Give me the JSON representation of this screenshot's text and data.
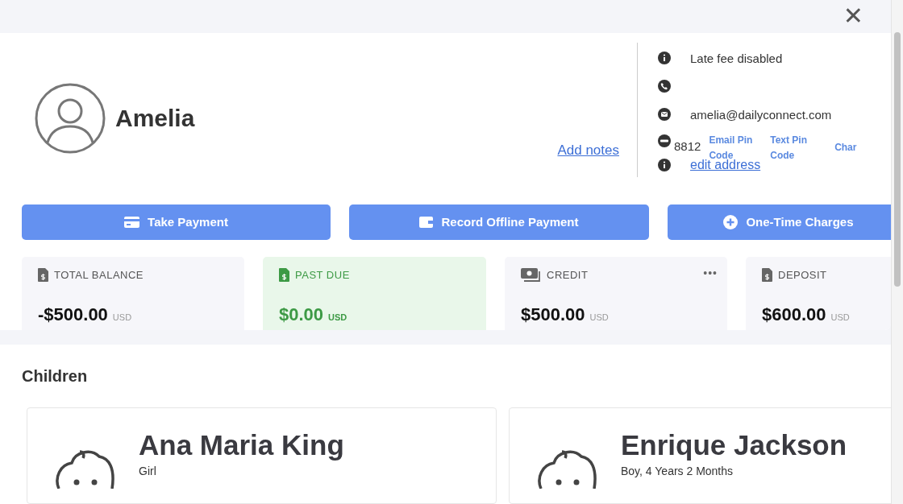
{
  "close_label": "✕",
  "profile": {
    "name": "Amelia",
    "add_notes": "Add notes"
  },
  "info": [
    {
      "kind": "info",
      "text": "Late fee disabled"
    },
    {
      "kind": "phone"
    },
    {
      "kind": "email",
      "text": "amelia@dailyconnect.com"
    },
    {
      "kind": "pin",
      "text": "8812",
      "links": [
        [
          "Email Pin",
          "Code"
        ],
        [
          "Text Pin",
          "Code"
        ],
        [
          "Char"
        ]
      ]
    },
    {
      "kind": "address",
      "link": "edit address"
    }
  ],
  "actions": [
    {
      "kind": "card",
      "label": "Take Payment"
    },
    {
      "kind": "wallet",
      "label": "Record Offline Payment"
    },
    {
      "kind": "plus",
      "label": "One-Time Charges"
    }
  ],
  "balances": [
    {
      "kind": "doc",
      "label": "TOTAL BALANCE",
      "amount": "-$500.00",
      "currency": "USD",
      "highlight": false
    },
    {
      "kind": "doc",
      "label": "PAST DUE",
      "amount": "$0.00",
      "currency": "USD",
      "highlight": true
    },
    {
      "kind": "cash",
      "label": "CREDIT",
      "amount": "$500.00",
      "currency": "USD",
      "highlight": false,
      "menu": "•••"
    },
    {
      "kind": "doc",
      "label": "DEPOSIT",
      "amount": "$600.00",
      "currency": "USD",
      "highlight": false
    }
  ],
  "children_title": "Children",
  "children": [
    {
      "name": "Ana Maria King",
      "detail": "Girl"
    },
    {
      "name": "Enrique Jackson",
      "detail": "Boy, 4 Years 2 Months"
    }
  ]
}
